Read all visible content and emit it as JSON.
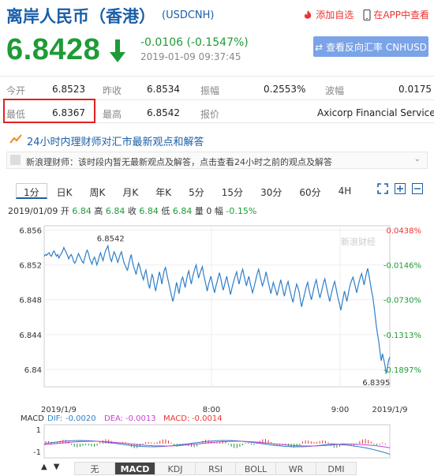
{
  "header": {
    "title": "离岸人民币（香港）",
    "code": "(USDCNH)",
    "add_watch": "添加自选",
    "app_view": "在APP中查看"
  },
  "quote": {
    "price": "6.8428",
    "change": "-0.0106 (-0.1547%)",
    "time": "2019-01-09 09:37:45",
    "reverse_button": "⇄ 查看反向汇率 CNHUSD"
  },
  "stats": [
    [
      {
        "label": "今开",
        "value": "6.8523"
      },
      {
        "label": "昨收",
        "value": "6.8534"
      },
      {
        "label": "振幅",
        "value": "0.2553%"
      },
      {
        "label": "波幅",
        "value": "0.0175"
      }
    ],
    [
      {
        "label": "最低",
        "value": "6.8367"
      },
      {
        "label": "最高",
        "value": "6.8542"
      },
      {
        "label": "报价",
        "value": "Axicorp Financial Services"
      }
    ]
  ],
  "expert": {
    "heading": "24小时内理财师对汇市最新观点和解答",
    "notice": "新浪理财师：该时段内暂无最新观点及解答，点击查看24小时之前的观点及解答"
  },
  "tabs": [
    "1分",
    "日K",
    "周K",
    "月K",
    "年K",
    "5分",
    "15分",
    "30分",
    "60分",
    "4H"
  ],
  "info": {
    "date": "2019/01/09",
    "open_label": "开",
    "open": "6.84",
    "high_label": "高",
    "high": "6.84",
    "close_label": "收",
    "close": "6.84",
    "low_label": "低",
    "low": "6.84",
    "volume_label": "量",
    "volume": "0",
    "amp_label": "幅",
    "amp": "-0.15%"
  },
  "chart_data": {
    "type": "line",
    "title": "",
    "ylim": [
      6.838,
      6.8565
    ],
    "y_ticks": [
      "6.856",
      "6.852",
      "6.848",
      "6.844",
      "6.84"
    ],
    "pct_ticks": [
      "0.0438%",
      "-0.0146%",
      "-0.0730%",
      "-0.1313%",
      "-0.1897%"
    ],
    "x_ticks": [
      "2019/1/9",
      "8:00",
      "9:00",
      "2019/1/9"
    ],
    "annotations": {
      "max": "6.8542",
      "min": "6.8395"
    },
    "watermark": "新浪财经",
    "line_color": "#2f7ec8",
    "series": [
      {
        "values": [
          6.853,
          6.8532,
          6.8531,
          6.8533,
          6.8534,
          6.8531,
          6.853,
          6.8534,
          6.8536,
          6.8533,
          6.853,
          6.8532,
          6.8528,
          6.8531,
          6.8533,
          6.8536,
          6.854,
          6.8537,
          6.8534,
          6.8531,
          6.8527,
          6.853,
          6.8532,
          6.8529,
          6.8524,
          6.8522,
          6.8525,
          6.8529,
          6.8533,
          6.853,
          6.8527,
          6.8524,
          6.8522,
          6.8528,
          6.8533,
          6.8537,
          6.8534,
          6.8528,
          6.8524,
          6.8521,
          6.8526,
          6.8529,
          6.8525,
          6.852,
          6.8524,
          6.853,
          6.8534,
          6.8529,
          6.8525,
          6.8531,
          6.8536,
          6.8539,
          6.8542,
          6.8534,
          6.8527,
          6.8524,
          6.853,
          6.8535,
          6.8532,
          6.8528,
          6.8523,
          6.8527,
          6.8532,
          6.8535,
          6.8529,
          6.8523,
          6.852,
          6.8516,
          6.8514,
          6.8521,
          6.8527,
          6.8532,
          6.8524,
          6.8518,
          6.8514,
          6.8509,
          6.8516,
          6.8522,
          6.8518,
          6.8512,
          6.8507,
          6.8503,
          6.851,
          6.8514,
          6.8506,
          6.8498,
          6.8493,
          6.8502,
          6.8509,
          6.8505,
          6.8496,
          6.849,
          6.8498,
          6.8505,
          6.8512,
          6.8506,
          6.8498,
          6.8507,
          6.8514,
          6.8517,
          6.851,
          6.8503,
          6.8497,
          6.849,
          6.8484,
          6.8478,
          6.8484,
          6.8492,
          6.85,
          6.8494,
          6.8487,
          6.8496,
          6.8503,
          6.8506,
          6.85,
          6.8494,
          6.8502,
          6.8509,
          6.8513,
          6.8505,
          6.8498,
          6.8505,
          6.8511,
          6.8516,
          6.852,
          6.8512,
          6.8505,
          6.851,
          6.8514,
          6.8518,
          6.851,
          6.8503,
          6.8497,
          6.849,
          6.8497,
          6.8502,
          6.8507,
          6.8501,
          6.8494,
          6.8488,
          6.8495,
          6.85,
          6.8506,
          6.8511,
          6.8505,
          6.8498,
          6.8491,
          6.8496,
          6.8502,
          6.8507,
          6.8499,
          6.8493,
          6.8486,
          6.8492,
          6.8498,
          6.8503,
          6.8508,
          6.8512,
          6.8504,
          6.8498,
          6.8505,
          6.8511,
          6.8515,
          6.8508,
          6.8502,
          6.8496,
          6.8502,
          6.8507,
          6.85,
          6.8494,
          6.8488,
          6.8493,
          6.8499,
          6.8505,
          6.8511,
          6.8515,
          6.8508,
          6.8502,
          6.8496,
          6.85,
          6.8505,
          6.8512,
          6.8506,
          6.8499,
          6.8493,
          6.8487,
          6.8494,
          6.85,
          6.8495,
          6.849,
          6.8485,
          6.8491,
          6.8497,
          6.8503,
          6.8497,
          6.849,
          6.8484,
          6.8491,
          6.8497,
          6.8501,
          6.8494,
          6.8488,
          6.8482,
          6.8477,
          6.8485,
          6.8492,
          6.8498,
          6.8494,
          6.8489,
          6.848,
          6.8472,
          6.8478,
          6.8484,
          6.849,
          6.8496,
          6.85,
          6.8492,
          6.8486,
          6.848,
          6.8486,
          6.8493,
          6.8499,
          6.8503,
          6.8495,
          6.8488,
          6.8482,
          6.8488,
          6.8494,
          6.85,
          6.8504,
          6.8497,
          6.849,
          6.8484,
          6.8478,
          6.8485,
          6.8491,
          6.8497,
          6.8501,
          6.8494,
          6.8487,
          6.848,
          6.8475,
          6.8468,
          6.8475,
          6.8483,
          6.849,
          6.8484,
          6.8478,
          6.8486,
          6.8493,
          6.8499,
          6.8503,
          6.8506,
          6.85,
          6.8494,
          6.8488,
          6.8495,
          6.8501,
          6.8506,
          6.851,
          6.8504,
          6.8497,
          6.8504,
          6.8511,
          6.8516,
          6.8508,
          6.85,
          6.8491,
          6.8484,
          6.8474,
          6.8462,
          6.845,
          6.844,
          6.8432,
          6.842,
          6.841,
          6.8418,
          6.8412,
          6.8405,
          6.8395,
          6.8402,
          6.841,
          6.8414
        ]
      }
    ]
  },
  "macd": {
    "label": "MACD",
    "dif_label": "DIF:",
    "dif": "-0.0020",
    "dea_label": "DEA:",
    "dea": "-0.0013",
    "macd_label": "MACD:",
    "macd": "-0.0014",
    "ticks": [
      "1",
      "-1"
    ]
  },
  "bottom_tabs": [
    "无",
    "MACD",
    "KDJ",
    "RSI",
    "BOLL",
    "WR",
    "DMI"
  ],
  "colors": {
    "green": "#1e9b36",
    "red": "#e33",
    "blue": "#1a5ea8"
  }
}
